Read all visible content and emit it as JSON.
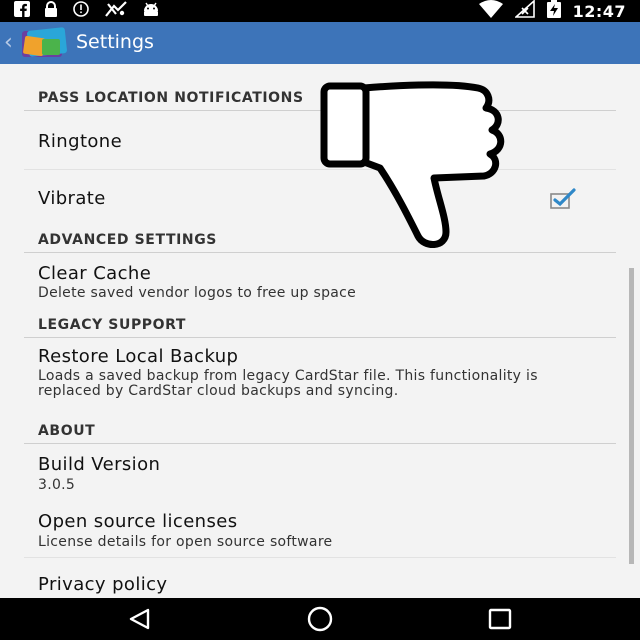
{
  "status_bar": {
    "time": "12:47",
    "left_icons": [
      "facebook-icon",
      "lock-icon",
      "alarm-icon",
      "notification-icon",
      "android-icon"
    ],
    "right_icons": [
      "wifi-icon",
      "no-signal-icon",
      "battery-charging-icon"
    ]
  },
  "action_bar": {
    "title": "Settings"
  },
  "sections": {
    "pass_location": {
      "header": "PASS LOCATION NOTIFICATIONS",
      "ringtone": "Ringtone",
      "vibrate": "Vibrate",
      "vibrate_checked": true
    },
    "advanced": {
      "header": "ADVANCED SETTINGS",
      "clear_cache_title": "Clear Cache",
      "clear_cache_summary": "Delete saved vendor logos to free up space"
    },
    "legacy": {
      "header": "LEGACY SUPPORT",
      "restore_title": "Restore Local Backup",
      "restore_summary": "Loads a saved backup from legacy CardStar file. This functionality is replaced by CardStar cloud backups and syncing."
    },
    "about": {
      "header": "ABOUT",
      "build_title": "Build Version",
      "build_value": "3.0.5",
      "oss_title": "Open source licenses",
      "oss_summary": "License details for open source software",
      "privacy_title": "Privacy policy"
    }
  },
  "colors": {
    "action_bar": "#3d74b9",
    "checkbox_accent": "#2f88c8",
    "background": "#f3f3f3"
  },
  "overlay": {
    "icon": "thumbs-down-icon"
  },
  "nav_bar": {
    "icons": [
      "back-icon",
      "home-icon",
      "recents-icon"
    ]
  }
}
